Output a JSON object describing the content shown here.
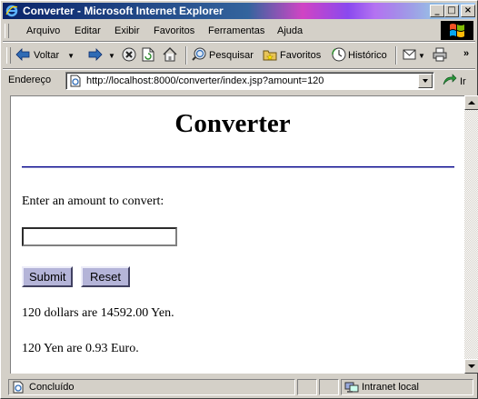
{
  "window": {
    "title": "Converter - Microsoft Internet Explorer"
  },
  "caption_buttons": {
    "minimize": "_",
    "maximize": "□",
    "close": "×"
  },
  "menu": {
    "items": [
      {
        "label": "Arquivo"
      },
      {
        "label": "Editar"
      },
      {
        "label": "Exibir"
      },
      {
        "label": "Favoritos"
      },
      {
        "label": "Ferramentas"
      },
      {
        "label": "Ajuda"
      }
    ]
  },
  "toolbar": {
    "back_label": "Voltar",
    "search_label": "Pesquisar",
    "favorites_label": "Favoritos",
    "history_label": "Histórico",
    "chevron": "»"
  },
  "address": {
    "label": "Endereço",
    "url": "http://localhost:8000/converter/index.jsp?amount=120",
    "go_label": "Ir"
  },
  "page": {
    "heading": "Converter",
    "prompt": "Enter an amount to convert:",
    "amount_value": "",
    "submit_label": "Submit",
    "reset_label": "Reset",
    "result_yen": "120 dollars are 14592.00 Yen.",
    "result_euro": "120 Yen are 0.93 Euro."
  },
  "status": {
    "text": "Concluído",
    "zone": "Intranet local"
  },
  "colors": {
    "titlebar_start": "#0a246a",
    "rule": "#00008b",
    "form_button": "#b4b4d8"
  }
}
